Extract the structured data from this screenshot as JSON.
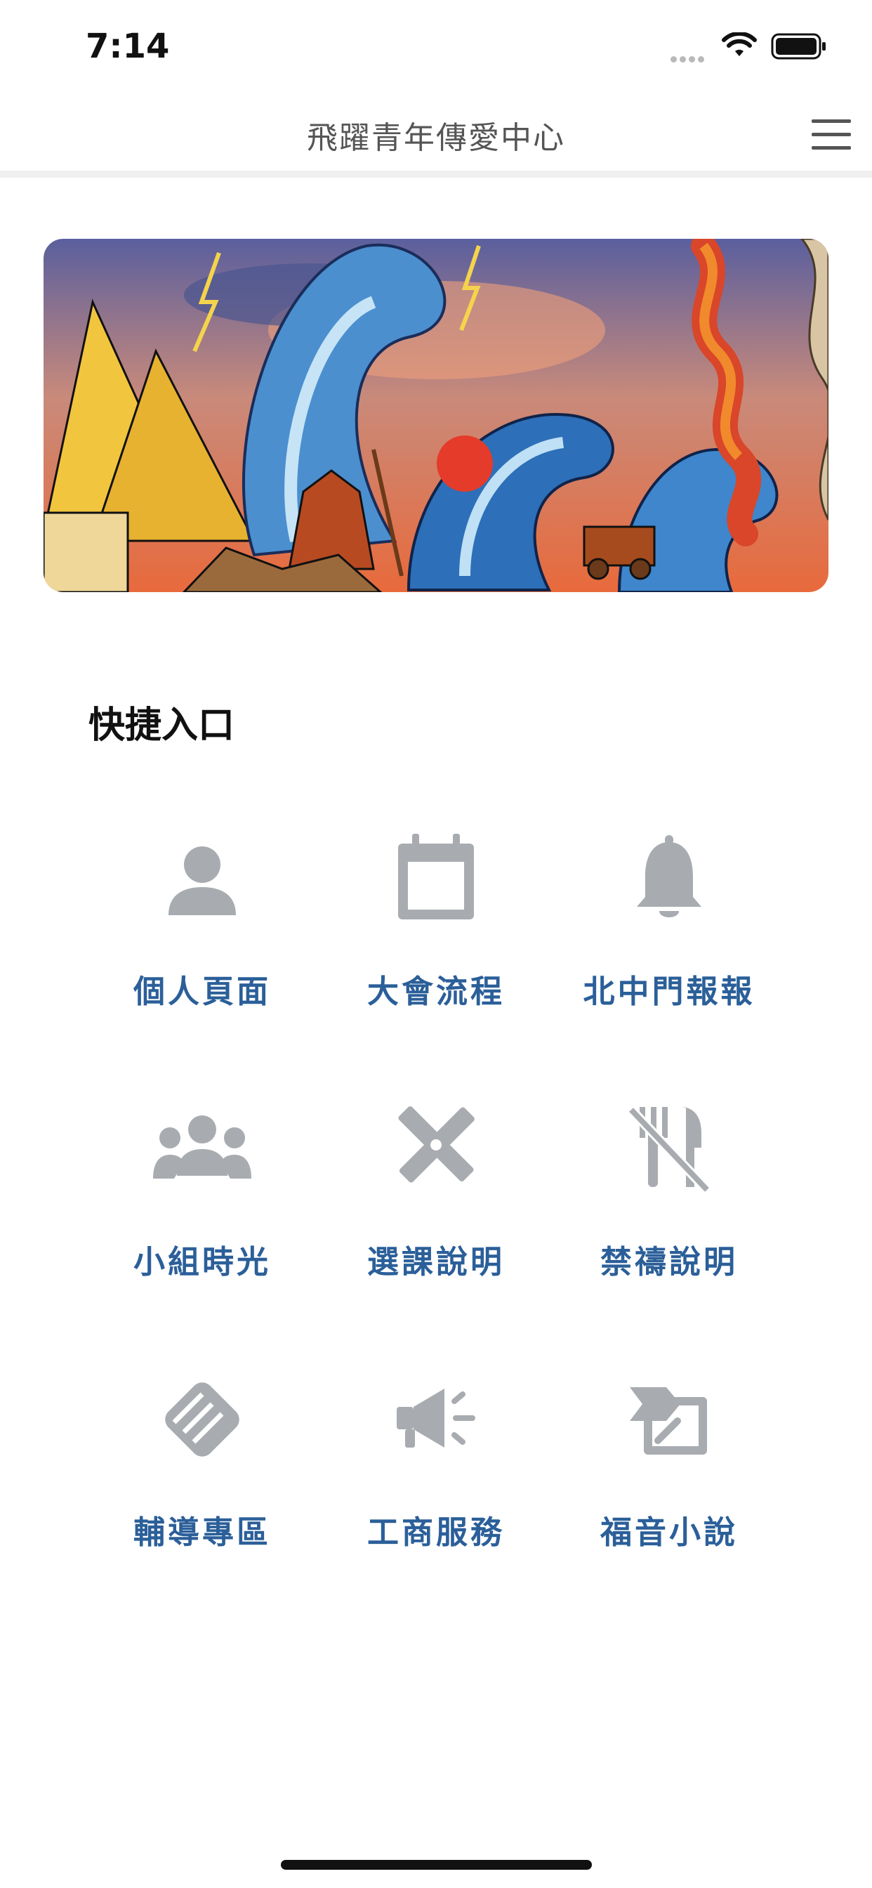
{
  "status_bar": {
    "time": "7:14"
  },
  "nav": {
    "title": "飛躍青年傳愛中心",
    "menu_icon": "hamburger-menu-icon"
  },
  "banner": {
    "description_icon": "illustration-red-sea-crossing"
  },
  "quick_access": {
    "title": "快捷入口",
    "items": [
      {
        "label": "個人頁面",
        "icon": "person-icon"
      },
      {
        "label": "大會流程",
        "icon": "calendar-icon"
      },
      {
        "label": "北中門報報",
        "icon": "bell-icon"
      },
      {
        "label": "小組時光",
        "icon": "group-icon"
      },
      {
        "label": "選課說明",
        "icon": "pencil-ruler-icon"
      },
      {
        "label": "禁禱說明",
        "icon": "utensils-slash-icon"
      },
      {
        "label": "輔導專區",
        "icon": "handshake-icon"
      },
      {
        "label": "工商服務",
        "icon": "megaphone-icon"
      },
      {
        "label": "福音小說",
        "icon": "sign-board-icon"
      }
    ]
  },
  "colors": {
    "label": "#2b5f99",
    "icon": "#a8acb0",
    "title": "#555555"
  }
}
